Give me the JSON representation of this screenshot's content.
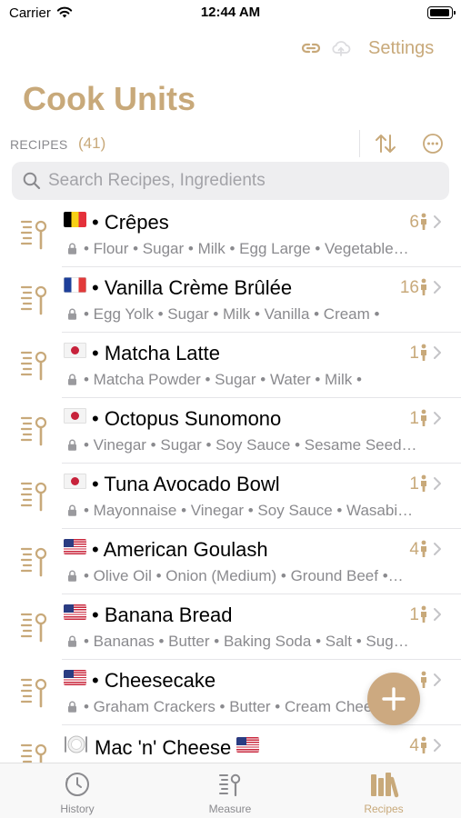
{
  "status": {
    "carrier": "Carrier",
    "time": "12:44 AM"
  },
  "toolbar": {
    "settings_label": "Settings"
  },
  "app": {
    "title": "Cook Units"
  },
  "section": {
    "label": "RECIPES",
    "count": "(41)"
  },
  "search": {
    "placeholder": "Search Recipes, Ingredients"
  },
  "recipes": [
    {
      "title": "• Crêpes",
      "flag": "be",
      "ingredients": "• Flour • Sugar • Milk • Egg Large • Vegetable…",
      "servings": "6"
    },
    {
      "title": "• Vanilla Crème Brûlée",
      "flag": "fr",
      "ingredients": "• Egg Yolk • Sugar • Milk • Vanilla • Cream •",
      "servings": "16"
    },
    {
      "title": "• Matcha Latte",
      "flag": "jp",
      "ingredients": "• Matcha Powder • Sugar • Water • Milk •",
      "servings": "1"
    },
    {
      "title": "• Octopus Sunomono",
      "flag": "jp",
      "ingredients": "• Vinegar • Sugar • Soy Sauce • Sesame Seed…",
      "servings": "1"
    },
    {
      "title": "• Tuna Avocado Bowl",
      "flag": "jp",
      "ingredients": "• Mayonnaise • Vinegar • Soy Sauce • Wasabi…",
      "servings": "1"
    },
    {
      "title": "• American Goulash",
      "flag": "us",
      "ingredients": "• Olive Oil • Onion (Medium) • Ground Beef •…",
      "servings": "4"
    },
    {
      "title": "• Banana Bread",
      "flag": "us",
      "ingredients": "• Bananas • Butter • Baking Soda • Salt • Sug…",
      "servings": "1"
    },
    {
      "title": "• Cheesecake",
      "flag": "us",
      "ingredients": "• Graham Crackers • Butter • Cream Cheese •…",
      "servings": ""
    },
    {
      "title": "Mac 'n' Cheese",
      "flag": "us",
      "ingredients": "",
      "servings": "4"
    }
  ],
  "tabs": [
    {
      "label": "History",
      "icon": "clock-icon",
      "active": false
    },
    {
      "label": "Measure",
      "icon": "measure-icon",
      "active": false
    },
    {
      "label": "Recipes",
      "icon": "books-icon",
      "active": true
    }
  ],
  "colors": {
    "accent": "#c8a97a",
    "secondary_text": "#8a8a8e",
    "search_bg": "#eeeef0"
  }
}
